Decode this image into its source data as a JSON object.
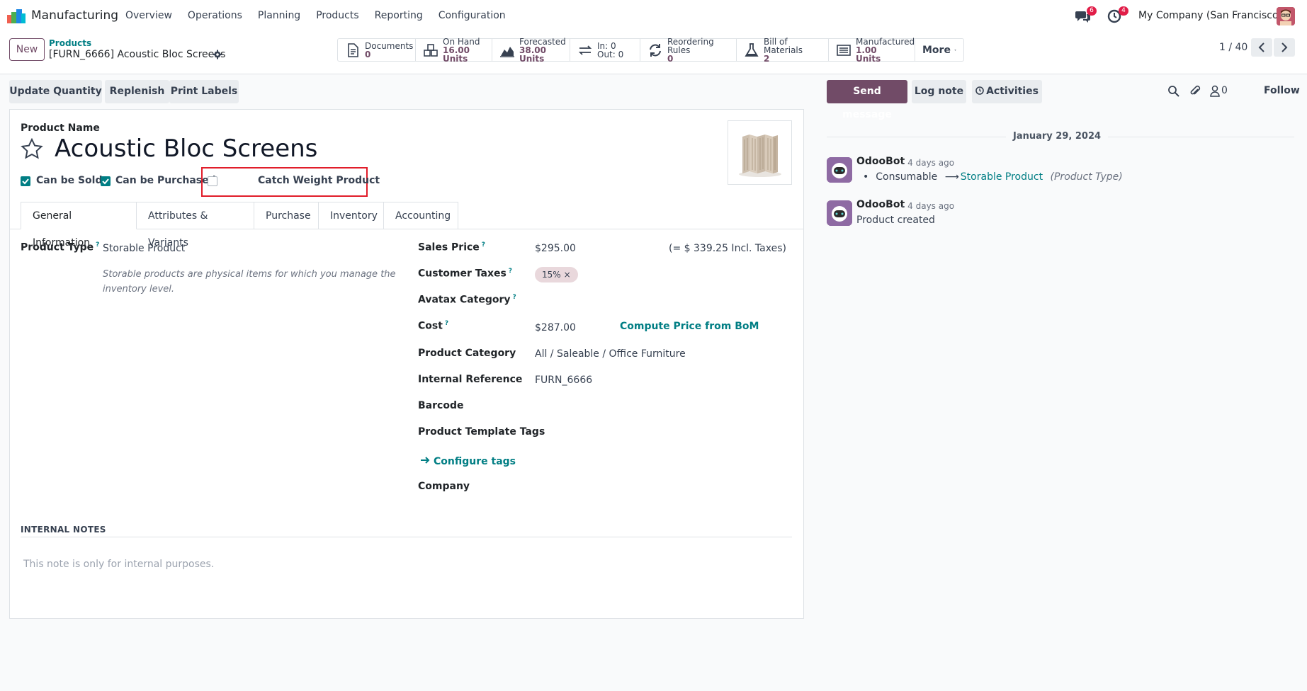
{
  "app": {
    "name": "Manufacturing"
  },
  "menu": [
    "Overview",
    "Operations",
    "Planning",
    "Products",
    "Reporting",
    "Configuration"
  ],
  "systray": {
    "messages_count": "6",
    "activities_count": "4",
    "company": "My Company (San Francisco)"
  },
  "control": {
    "new_label": "New",
    "breadcrumb_parent": "Products",
    "breadcrumb_current": "[FURN_6666] Acoustic Bloc Screens",
    "pager": "1 / 40"
  },
  "stats": {
    "documents": {
      "label": "Documents",
      "value": "0"
    },
    "on_hand": {
      "label": "On Hand",
      "value": "16.00 Units"
    },
    "forecasted": {
      "label": "Forecasted",
      "value": "38.00 Units"
    },
    "in_out": {
      "in": "In: 0",
      "out": "Out: 0"
    },
    "reordering": {
      "label": "Reordering Rules",
      "value": "0"
    },
    "bom": {
      "label": "Bill of Materials",
      "value": "2"
    },
    "manufactured": {
      "label": "Manufactured",
      "value1": "1.00",
      "value2": "Units"
    },
    "more": "More"
  },
  "actions": {
    "update_qty": "Update Quantity",
    "replenish": "Replenish",
    "print_labels": "Print Labels"
  },
  "form": {
    "product_name_label": "Product Name",
    "title": "Acoustic Bloc Screens",
    "can_be_sold": "Can be Sold",
    "can_be_purchased": "Can be Purchased",
    "catch_weight": "Catch Weight Product",
    "tabs": [
      "General Information",
      "Attributes & Variants",
      "Purchase",
      "Inventory",
      "Accounting"
    ],
    "product_type_label": "Product Type",
    "product_type_value": "Storable Product",
    "product_type_hint": "Storable products are physical items for which you manage the inventory level.",
    "sales_price_label": "Sales Price",
    "sales_price_value": "$295.00",
    "sales_price_incl": "(= $ 339.25 Incl. Taxes)",
    "customer_taxes_label": "Customer Taxes",
    "customer_taxes_tag": "15%",
    "avatax_label": "Avatax Category",
    "cost_label": "Cost",
    "cost_value": "$287.00",
    "compute_bom": "Compute Price from BoM",
    "category_label": "Product Category",
    "category_value": "All / Saleable / Office Furniture",
    "internal_ref_label": "Internal Reference",
    "internal_ref_value": "FURN_6666",
    "barcode_label": "Barcode",
    "template_tags_label": "Product Template Tags",
    "configure_tags": "Configure tags",
    "company_label": "Company",
    "notes_title": "INTERNAL NOTES",
    "notes_placeholder": "This note is only for internal purposes."
  },
  "chatter": {
    "send_message": "Send message",
    "log_note": "Log note",
    "activities": "Activities",
    "followers_count": "0",
    "follow": "Follow",
    "date": "January 29, 2024",
    "messages": [
      {
        "author": "OdooBot",
        "time": "- 4 days ago",
        "old": "Consumable",
        "new": "Storable Product",
        "field": "(Product Type)"
      },
      {
        "author": "OdooBot",
        "time": "- 4 days ago",
        "body": "Product created"
      }
    ]
  },
  "colors": {
    "brand": "#714b67",
    "teal": "#017e84",
    "highlight": "#e11d2a"
  }
}
